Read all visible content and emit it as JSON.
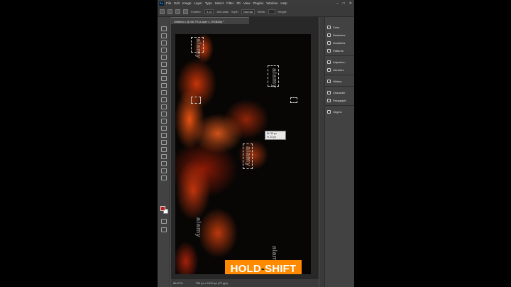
{
  "menubar": {
    "items": [
      "File",
      "Edit",
      "Image",
      "Layer",
      "Type",
      "Select",
      "Filter",
      "3D",
      "View",
      "Plugins",
      "Window",
      "Help"
    ]
  },
  "optionsbar": {
    "feather_label": "Feather:",
    "feather_value": "0 px",
    "antialias_label": "Anti-alias",
    "style_label": "Style:",
    "style_value": "Normal",
    "width_label": "Width:",
    "height_label": "Height:"
  },
  "document": {
    "tab_title": "Untitled-1 @ 66.7% (Layer 1, RGB/8#) *",
    "measure_w": "W: 39 px",
    "measure_h": "H: 22 px",
    "banner_left": "HOLD",
    "banner_dash": "-",
    "banner_right": "SHIFT",
    "watermark": "alamy"
  },
  "status": {
    "zoom": "66.67%",
    "size": "754 px x 1340 px (72 ppi)"
  },
  "panels": {
    "items": [
      "Color",
      "Swatches",
      "Gradients",
      "Patterns",
      "Adjustme...",
      "Libraries",
      "History",
      "Character",
      "Paragraph",
      "Glyphs"
    ]
  },
  "colors": {
    "foreground": "#c41d1d",
    "background": "#ffffff",
    "banner": "#ff8a00"
  }
}
